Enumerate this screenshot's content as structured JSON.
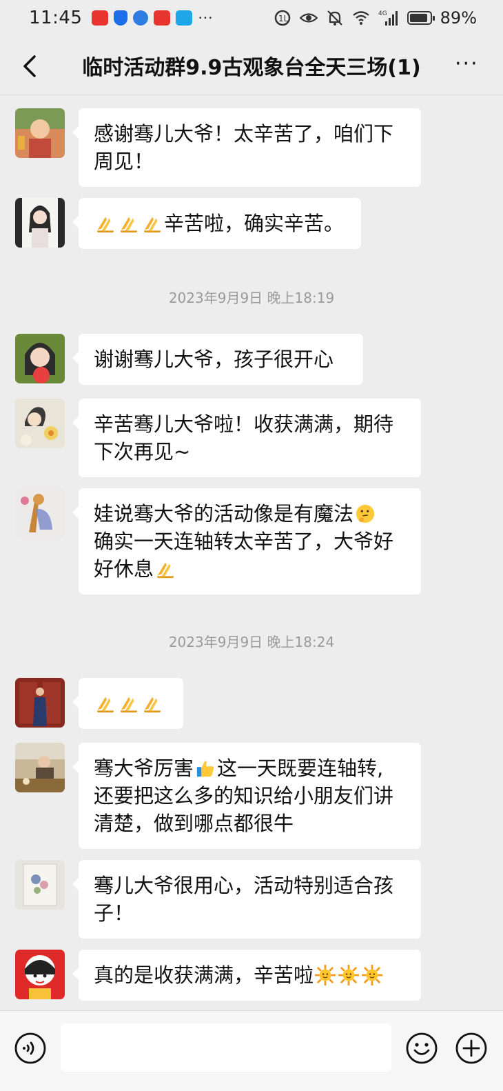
{
  "status_bar": {
    "time": "11:45",
    "app_icons": [
      "red-app-icon",
      "shield-app-icon",
      "globe-app-icon",
      "red-app-icon",
      "search-app-icon"
    ],
    "overflow": "···",
    "network": "4G",
    "battery_percent": 89,
    "battery_label": "89%"
  },
  "header": {
    "title": "临时活动群9.9古观象台全天三场(1)",
    "back_icon": "chevron-left-icon",
    "more_icon": "more-dots-icon",
    "more_label": "···"
  },
  "messages": [
    {
      "avatar_colors": [
        "#d98a5a",
        "#7a9a55",
        "#c24a3a"
      ],
      "lines": [
        "感谢骞儿大爷！太辛苦了，咱们下",
        "周见！"
      ]
    },
    {
      "avatar_colors": [
        "#f4f4f0",
        "#2a2a2a",
        "#e8dede"
      ],
      "emoji_prefix": [
        "pray-emoji",
        "pray-emoji",
        "pray-emoji"
      ],
      "text": "辛苦啦，确实辛苦。"
    },
    {
      "avatar_colors": [
        "#6a8a3a",
        "#2c2c2c",
        "#e83f40"
      ],
      "text": "谢谢骞儿大爷，孩子很开心"
    },
    {
      "avatar_colors": [
        "#e8e4d8",
        "#3a3a3a",
        "#f0d060"
      ],
      "lines": [
        "辛苦骞儿大爷啦！收获满满，期待",
        "下次再见~"
      ]
    },
    {
      "avatar_colors": [
        "#ecebea",
        "#c8863a",
        "#7a8ac8"
      ],
      "line1": "娃说骞大爷的活动像是有魔法",
      "line1_emoji": "thinking-emoji",
      "line2": "确实一天连轴转太辛苦了，大爷好",
      "line3": "好休息",
      "line3_emoji": "pray-emoji"
    },
    {
      "avatar_colors": [
        "#8a2a1e",
        "#2a3a6a",
        "#c04030"
      ],
      "emojis": [
        "pray-emoji",
        "pray-emoji",
        "pray-emoji"
      ]
    },
    {
      "avatar_colors": [
        "#c8b898",
        "#5a4a3a",
        "#e0d8c8"
      ],
      "line1_a": "骞大爷厉害",
      "line1_emoji": "thumbs-up-emoji",
      "line1_b": "这一天既要连轴转,",
      "line2": "还要把这么多的知识给小朋友们讲",
      "line3": "清楚，做到哪点都很牛"
    },
    {
      "avatar_colors": [
        "#e6e4de",
        "#7a90b8",
        "#d8a0a8"
      ],
      "lines": [
        "骞儿大爷很用心，活动特别适合孩",
        "子！"
      ]
    },
    {
      "avatar_colors": [
        "#e02a2a",
        "#ffffff",
        "#222222"
      ],
      "text": "真的是收获满满，辛苦啦",
      "emojis": [
        "sun-emoji",
        "sun-emoji",
        "sun-emoji"
      ]
    }
  ],
  "timestamps": [
    "2023年9月9日 晚上18:19",
    "2023年9月9日 晚上18:24"
  ],
  "input_bar": {
    "voice_icon": "voice-icon",
    "text_value": "",
    "emoji_icon": "emoji-icon",
    "plus_icon": "plus-icon"
  },
  "colors": {
    "background": "#ededed",
    "bubble": "#ffffff",
    "timestamp": "#9a9a9a"
  }
}
